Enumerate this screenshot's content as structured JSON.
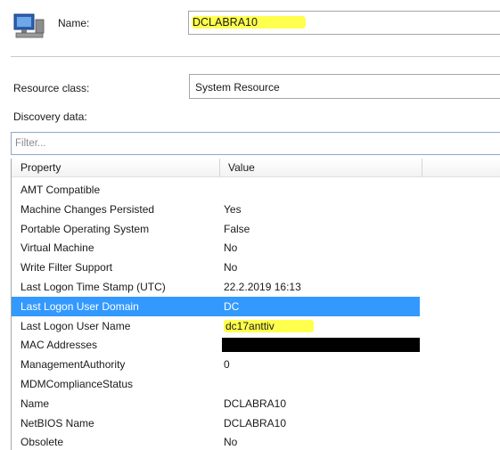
{
  "header": {
    "name_label": "Name:",
    "name_value": "DCLABRA10",
    "icon": "computer-icon"
  },
  "resource_class": {
    "label": "Resource class:",
    "value": "System Resource"
  },
  "discovery": {
    "label": "Discovery data:"
  },
  "filter": {
    "placeholder": "Filter..."
  },
  "table": {
    "columns": [
      "Property",
      "Value"
    ],
    "rows": [
      {
        "property": "AMT Compatible",
        "value": ""
      },
      {
        "property": "Machine Changes Persisted",
        "value": "Yes"
      },
      {
        "property": "Portable Operating System",
        "value": "False"
      },
      {
        "property": "Virtual Machine",
        "value": "No"
      },
      {
        "property": "Write Filter Support",
        "value": "No"
      },
      {
        "property": "Last Logon Time Stamp (UTC)",
        "value": "22.2.2019 16:13"
      },
      {
        "property": "Last Logon User Domain",
        "value": "DC"
      },
      {
        "property": "Last Logon User Name",
        "value": "dc17anttiv"
      },
      {
        "property": "MAC Addresses",
        "value": ""
      },
      {
        "property": "ManagementAuthority",
        "value": "0"
      },
      {
        "property": "MDMComplianceStatus",
        "value": ""
      },
      {
        "property": "Name",
        "value": "DCLABRA10"
      },
      {
        "property": "NetBIOS Name",
        "value": "DCLABRA10"
      },
      {
        "property": "Obsolete",
        "value": "No"
      }
    ]
  },
  "colors": {
    "selection": "#3399ff",
    "highlight": "#ffff4d",
    "redaction": "#000000"
  }
}
